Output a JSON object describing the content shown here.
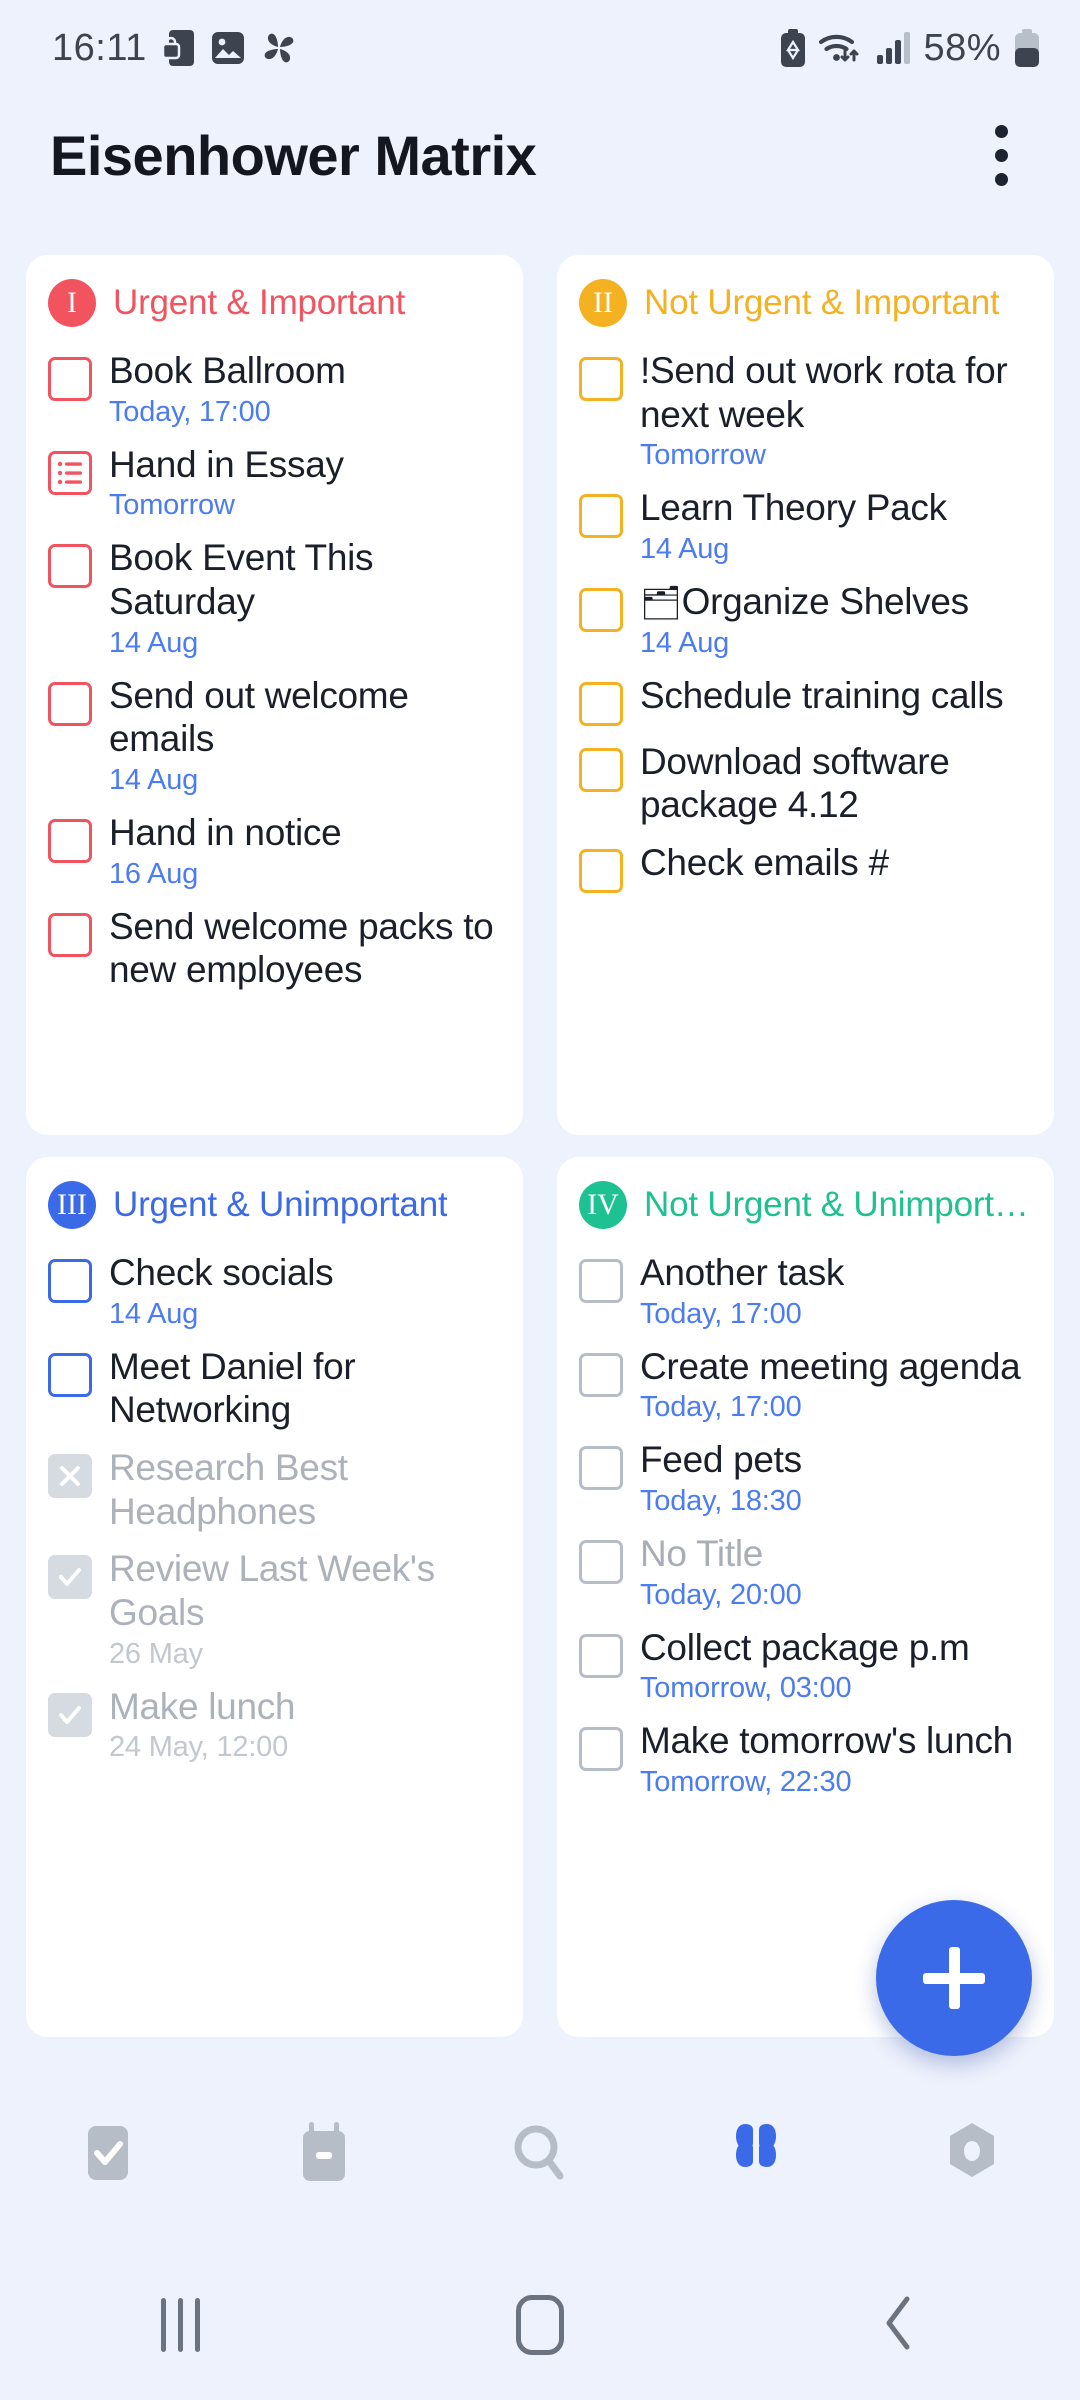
{
  "status_bar": {
    "time": "16:11",
    "battery_percent": "58%",
    "left_icons": [
      "phone-lock-icon",
      "image-icon",
      "pinwheel-icon"
    ],
    "right_icons": [
      "battery-saver-icon",
      "wifi-icon",
      "signal-icon",
      "battery-icon"
    ]
  },
  "app_bar": {
    "title": "Eisenhower Matrix",
    "overflow_menu": "more-options"
  },
  "colors": {
    "background": "#eef2fc",
    "card": "#ffffff",
    "accent_blue": "#3b6ae8",
    "date_blue": "#4c7cf2",
    "q1": "#f2545f",
    "q2": "#f4b223",
    "q3": "#3b6ae8",
    "q4": "#1ec191",
    "muted": "#adb2ba"
  },
  "quadrants": [
    {
      "numeral": "I",
      "title": "Urgent & Important",
      "color": "#f2545f",
      "tasks": [
        {
          "title": "Book Ballroom",
          "date": "Today, 17:00",
          "state": "open",
          "checkbox": "checkbox-empty"
        },
        {
          "title": "Hand in Essay",
          "date": "Tomorrow",
          "state": "open",
          "checkbox": "subtask-list-icon"
        },
        {
          "title": "Book Event This Saturday",
          "date": "14 Aug",
          "state": "open",
          "checkbox": "checkbox-empty"
        },
        {
          "title": "Send out welcome emails",
          "date": "14 Aug",
          "state": "open",
          "checkbox": "checkbox-empty"
        },
        {
          "title": "Hand in notice",
          "date": "16 Aug",
          "state": "open",
          "checkbox": "checkbox-empty"
        },
        {
          "title": "Send welcome packs to new employees",
          "date": "",
          "state": "open",
          "checkbox": "checkbox-empty"
        }
      ]
    },
    {
      "numeral": "II",
      "title": "Not Urgent & Important",
      "color": "#f4b223",
      "tasks": [
        {
          "title": "!Send out work rota for next week",
          "date": "Tomorrow",
          "state": "open",
          "checkbox": "checkbox-empty"
        },
        {
          "title": "Learn Theory Pack",
          "date": "14 Aug",
          "state": "open",
          "checkbox": "checkbox-empty"
        },
        {
          "title": "Organize Shelves",
          "emoji": "🗂",
          "date": "14 Aug",
          "state": "open",
          "checkbox": "checkbox-empty"
        },
        {
          "title": "Schedule training calls",
          "date": "",
          "state": "open",
          "checkbox": "checkbox-empty"
        },
        {
          "title": "Download software package 4.12",
          "date": "",
          "state": "open",
          "checkbox": "checkbox-empty"
        },
        {
          "title": "Check emails  #",
          "date": "",
          "state": "open",
          "checkbox": "checkbox-empty"
        }
      ]
    },
    {
      "numeral": "III",
      "title": "Urgent & Unimportant",
      "color": "#3b6ae8",
      "tasks": [
        {
          "title": "Check socials",
          "date": "14 Aug",
          "state": "open",
          "checkbox": "checkbox-empty"
        },
        {
          "title": "Meet Daniel for Networking",
          "date": "",
          "state": "open",
          "checkbox": "checkbox-empty"
        },
        {
          "title": "Research Best Headphones",
          "date": "",
          "state": "cancelled",
          "checkbox": "checkbox-cancelled"
        },
        {
          "title": "Review Last Week's Goals",
          "date": "26 May",
          "state": "done",
          "checkbox": "checkbox-checked"
        },
        {
          "title": "Make lunch",
          "date": "24 May, 12:00",
          "state": "done",
          "checkbox": "checkbox-checked"
        }
      ]
    },
    {
      "numeral": "IV",
      "title": "Not Urgent & Unimport…",
      "color": "#1ec191",
      "tasks": [
        {
          "title": "Another task",
          "date": "Today, 17:00",
          "state": "open",
          "checkbox": "checkbox-empty"
        },
        {
          "title": "Create meeting agenda",
          "date": "Today, 17:00",
          "state": "open",
          "checkbox": "checkbox-empty"
        },
        {
          "title": "Feed pets",
          "date": "Today, 18:30",
          "state": "open",
          "checkbox": "checkbox-empty"
        },
        {
          "title": "No Title",
          "date": "Today, 20:00",
          "state": "untitled",
          "checkbox": "checkbox-empty"
        },
        {
          "title": "Collect package p.m",
          "date": "Tomorrow, 03:00",
          "state": "open",
          "checkbox": "checkbox-empty"
        },
        {
          "title": "Make tomorrow's lunch",
          "date": "Tomorrow, 22:30",
          "state": "open",
          "checkbox": "checkbox-empty"
        }
      ]
    }
  ],
  "fab": {
    "label": "+",
    "name": "add-task-button"
  },
  "bottom_nav": [
    {
      "icon": "tasks-checkbox-icon",
      "active": false
    },
    {
      "icon": "calendar-icon",
      "active": false
    },
    {
      "icon": "search-icon",
      "active": false
    },
    {
      "icon": "matrix-grid-icon",
      "active": true
    },
    {
      "icon": "settings-gear-icon",
      "active": false
    }
  ],
  "android_nav": [
    {
      "icon": "recents-icon"
    },
    {
      "icon": "home-icon"
    },
    {
      "icon": "back-icon"
    }
  ]
}
